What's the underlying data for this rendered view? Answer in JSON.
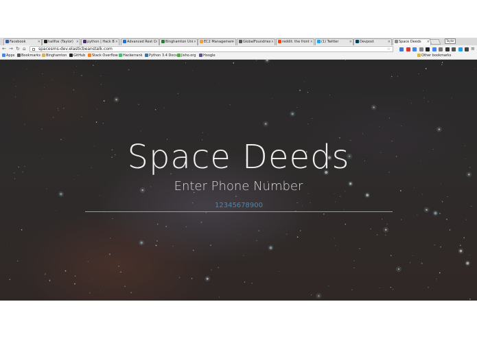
{
  "browser": {
    "tabs": [
      {
        "label": "Facebook",
        "color": "#3b5998"
      },
      {
        "label": "hallfox (Taylor)",
        "color": "#222222"
      },
      {
        "label": "python | Hack B",
        "color": "#4d2c6e"
      },
      {
        "label": "Advanced Rest C",
        "color": "#1e6fd9"
      },
      {
        "label": "Binghamton Uni",
        "color": "#2a7a3b"
      },
      {
        "label": "EC2 Managemen",
        "color": "#f0a030"
      },
      {
        "label": "GlobalFoundries",
        "color": "#555555"
      },
      {
        "label": "reddit: the front",
        "color": "#ff4500"
      },
      {
        "label": "(1) Twitter",
        "color": "#1da1f2"
      },
      {
        "label": "Devpost",
        "color": "#003e54"
      },
      {
        "label": "Space Deeds",
        "color": "#888888"
      }
    ],
    "profile_badge": "Taylor",
    "url": "spacesms-dev.elasticbeanstalk.com",
    "bookmarks": [
      {
        "label": "Apps",
        "color": "#4285f4"
      },
      {
        "label": "Bookmarks",
        "color": "#555555"
      },
      {
        "label": "Binghamton",
        "color": "#d9b44a"
      },
      {
        "label": "GitHub",
        "color": "#222222"
      },
      {
        "label": "Stack Overflow",
        "color": "#f48024"
      },
      {
        "label": "Hackerrank",
        "color": "#2ec866"
      },
      {
        "label": "Python 3.4 Docs",
        "color": "#3776ab"
      },
      {
        "label": "Jisho.org",
        "color": "#56a846"
      },
      {
        "label": "Hoogle",
        "color": "#5e5086"
      }
    ],
    "other_bookmarks": "Other bookmarks",
    "extension_colors": [
      "#3a7bd5",
      "#d33",
      "#4285f4",
      "#888",
      "#222",
      "#4285f4",
      "#777",
      "#333",
      "#555",
      "#1da1f2",
      "#444"
    ]
  },
  "page": {
    "title": "Space Deeds",
    "subtitle": "Enter Phone Number",
    "phone_value": "12345678900",
    "accent": "#4a88b0"
  }
}
